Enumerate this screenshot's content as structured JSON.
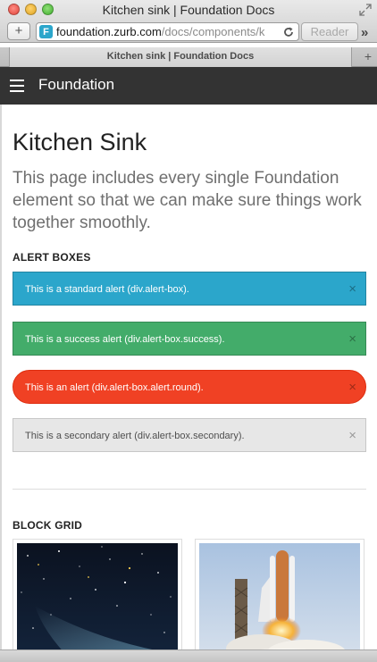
{
  "window": {
    "title": "Kitchen sink | Foundation Docs",
    "add_tab": "+",
    "url_domain": "foundation.zurb.com",
    "url_path": "/docs/components/k",
    "favicon": "F",
    "reader_label": "Reader",
    "overflow": "»",
    "tab_title": "Kitchen sink | Foundation Docs",
    "tab_add": "+"
  },
  "topbar": {
    "brand": "Foundation"
  },
  "page": {
    "title": "Kitchen Sink",
    "lead": "This page includes every single Foundation element so that we can make sure things work together smoothly."
  },
  "sections": {
    "alert_boxes": "ALERT BOXES",
    "block_grid": "BLOCK GRID"
  },
  "alerts": [
    {
      "text": "This is a standard alert (div.alert-box).",
      "close": "×"
    },
    {
      "text": "This is a success alert (div.alert-box.success).",
      "close": "×"
    },
    {
      "text": "This is an alert (div.alert-box.alert.round).",
      "close": "×"
    },
    {
      "text": "This is a secondary alert (div.alert-box.secondary).",
      "close": "×"
    }
  ],
  "colors": {
    "standard": "#2ba6cb",
    "success": "#43ac6a",
    "alert": "#f04124",
    "secondary": "#e7e7e7",
    "topbar": "#333333"
  },
  "block_grid": {
    "images": [
      "starfield-comet-image",
      "space-shuttle-launch-image"
    ]
  }
}
